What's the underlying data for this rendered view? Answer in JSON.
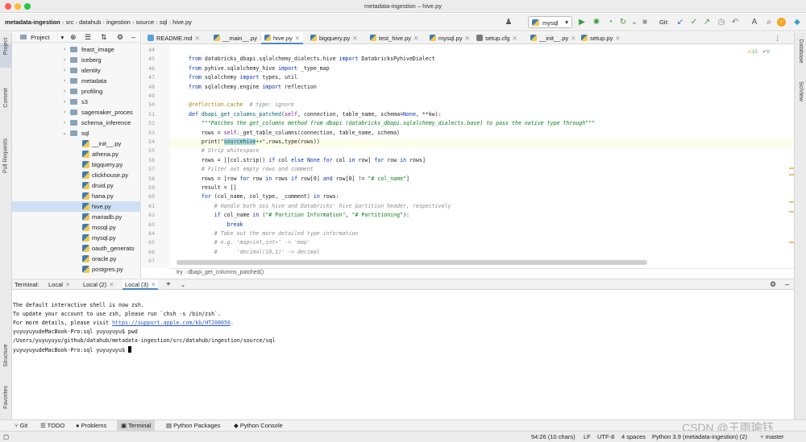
{
  "window": {
    "title": "metadata-ingestion – hive.py"
  },
  "breadcrumb": [
    "metadata-ingestion",
    "src",
    "datahub",
    "ingestion",
    "source",
    "sql",
    "hive.py"
  ],
  "toolbar": {
    "run_config": "mysql",
    "git_label": "Git:"
  },
  "left_tabs": [
    "Project",
    "Commit",
    "Pull Requests",
    "Structure",
    "Favorites"
  ],
  "right_tabs": [
    "Database",
    "SciView"
  ],
  "project": {
    "header": "Project",
    "items": [
      {
        "label": "feast_image",
        "type": "folder",
        "collapsed": true
      },
      {
        "label": "iceberg",
        "type": "folder",
        "collapsed": true
      },
      {
        "label": "identity",
        "type": "folder",
        "collapsed": true
      },
      {
        "label": "metadata",
        "type": "folder",
        "collapsed": true
      },
      {
        "label": "profiling",
        "type": "folder",
        "collapsed": true
      },
      {
        "label": "s3",
        "type": "folder",
        "collapsed": true
      },
      {
        "label": "sagemaker_proces",
        "type": "folder",
        "collapsed": true
      },
      {
        "label": "schema_inference",
        "type": "folder",
        "collapsed": true
      },
      {
        "label": "sql",
        "type": "folder",
        "collapsed": false
      },
      {
        "label": "__init__.py",
        "type": "file"
      },
      {
        "label": "athena.py",
        "type": "file"
      },
      {
        "label": "bigquery.py",
        "type": "file"
      },
      {
        "label": "clickhouse.py",
        "type": "file"
      },
      {
        "label": "druid.py",
        "type": "file"
      },
      {
        "label": "hana.py",
        "type": "file"
      },
      {
        "label": "hive.py",
        "type": "file",
        "selected": true
      },
      {
        "label": "mariadb.py",
        "type": "file"
      },
      {
        "label": "mssql.py",
        "type": "file"
      },
      {
        "label": "mysql.py",
        "type": "file"
      },
      {
        "label": "oauth_generato",
        "type": "file"
      },
      {
        "label": "oracle.py",
        "type": "file"
      },
      {
        "label": "postgres.py",
        "type": "file"
      }
    ]
  },
  "tabs": [
    "README.md",
    "__main__.py",
    "hive.py",
    "bigquery.py",
    "test_hive.py",
    "mysql.py",
    "setup.cfg",
    "__init__.py",
    "setup.py"
  ],
  "active_tab": "hive.py",
  "inspection": {
    "warnings": "15",
    "weak": "6"
  },
  "editor": {
    "line_numbers": [
      "44",
      "45",
      "46",
      "47",
      "48",
      "49",
      "50",
      "51",
      "52",
      "53",
      "54",
      "55",
      "56",
      "57",
      "58",
      "59",
      "60",
      "61",
      "62",
      "63",
      "64",
      "65",
      "66",
      "67"
    ],
    "lines": [
      "",
      "from databricks_dbapi.sqlalchemy_dialects.hive import DatabricksPyhiveDialect",
      "from pyhive.sqlalchemy_hive import _type_map",
      "from sqlalchemy import types, util",
      "from sqlalchemy.engine import reflection",
      "",
      "@reflection.cache  # type: ignore",
      "def dbapi_get_columns_patched(self, connection, table_name, schema=None, **kw):",
      "    \"\"\"Patches the get_columns method from dbapi (databricks_dbapi.sqlalchemy_dialects.base) to pass the native type through\"\"\"",
      "    rows = self._get_table_columns(connection, table_name, schema)",
      "    print(\"sourcehive++\",rows,type(rows))",
      "    # Strip whitespace",
      "    rows = [[col.strip() if col else None for col in row] for row in rows]",
      "    # Filter out empty rows and comment",
      "    rows = [row for row in rows if row[0] and row[0] != \"# col_name\"]",
      "    result = []",
      "    for (col_name, col_type, _comment) in rows:",
      "        # Handle both oss hive and Databricks' hive partition header, respectively",
      "        if col_name in (\"# Partition Information\", \"# Partitioning\"):",
      "            break",
      "        # Take out the more detailed type information",
      "        # e.g. 'map<int,int>' -> 'map'",
      "        #      'decimal(10,1)' -> decimal",
      ""
    ],
    "code_breadcrumb": [
      "try",
      "dbapi_get_columns_patched()"
    ]
  },
  "terminal": {
    "label": "Terminal:",
    "tabs": [
      "Local",
      "Local (2)",
      "Local (3)"
    ],
    "active": "Local (3)",
    "lines": [
      "The default interactive shell is now zsh.",
      "To update your account to use zsh, please run `chsh -s /bin/zsh`.",
      "For more details, please visit ",
      "yuyuyuyudeMacBook-Pro:sql yuyuyuyu$ pwd",
      "/Users/yuyuyuyu/github/datahub/metadata-ingestion/src/datahub/ingestion/source/sql",
      "yuyuyuyudeMacBook-Pro:sql yuyuyuyu$ "
    ],
    "link": "https://support.apple.com/kb/HT208050",
    "link_suffix": "."
  },
  "bottom_tabs": [
    "Git",
    "TODO",
    "Problems",
    "Terminal",
    "Python Packages",
    "Python Console"
  ],
  "status": {
    "position": "54:26 (10 chars)",
    "line_sep": "LF",
    "encoding": "UTF-8",
    "indent": "4 spaces",
    "interpreter": "Python 3.9 (metadata-ingestion) (2)",
    "branch": "master"
  },
  "watermark": "CSDN @王雨瑜钰",
  "colors": {
    "accent": "#4a86c8",
    "selection": "#cfe0f5",
    "keyword": "#0033b3",
    "string": "#067d17",
    "comment": "#8c8c8c"
  }
}
